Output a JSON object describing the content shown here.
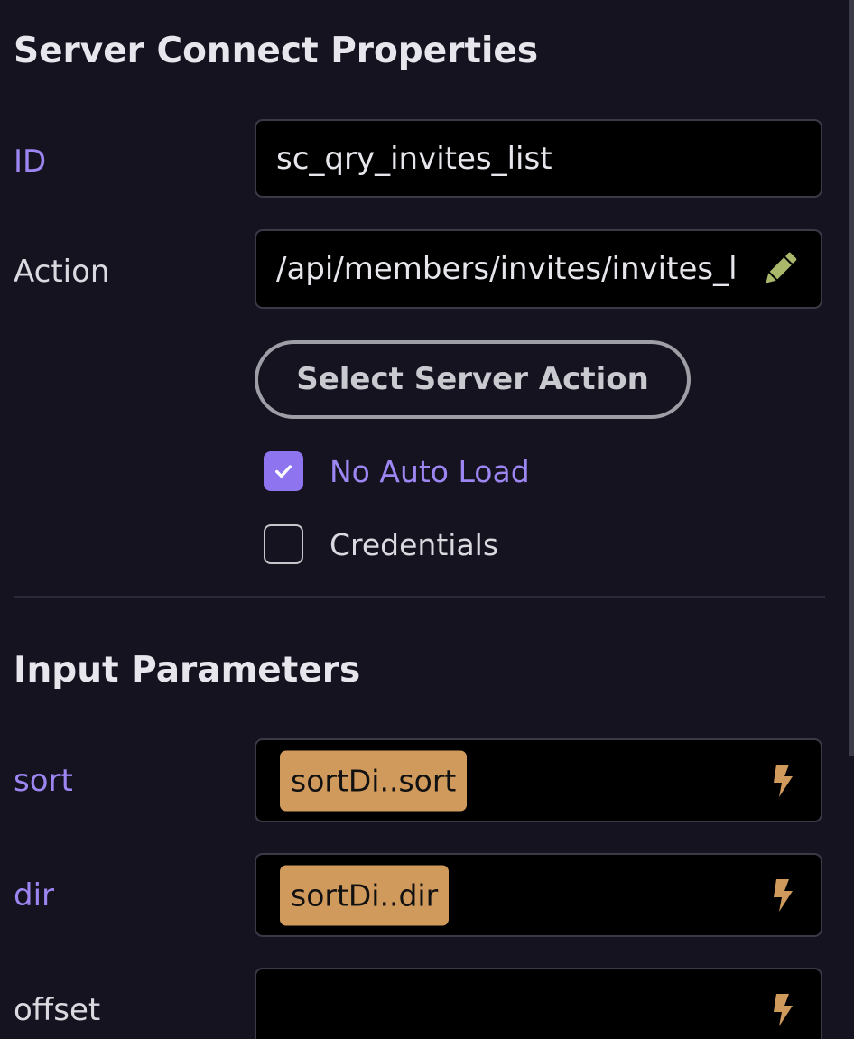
{
  "header": {
    "title": "Server Connect Properties"
  },
  "properties": {
    "id": {
      "label": "ID",
      "value": "sc_qry_invites_list"
    },
    "action": {
      "label": "Action",
      "value": "/api/members/invites/invites_l",
      "edit_icon": "pencil-icon"
    },
    "select_action_button": "Select Server Action",
    "no_auto_load": {
      "label": "No Auto Load",
      "checked": true
    },
    "credentials": {
      "label": "Credentials",
      "checked": false
    }
  },
  "input_parameters": {
    "title": "Input Parameters",
    "items": [
      {
        "label": "sort",
        "value": "sortDi..sort",
        "icon": "lightning-bolt-icon"
      },
      {
        "label": "dir",
        "value": "sortDi..dir",
        "icon": "lightning-bolt-icon"
      },
      {
        "label": "offset",
        "value": "",
        "icon": "lightning-bolt-icon"
      }
    ]
  },
  "colors": {
    "background": "#14131f",
    "accent": "#9d85f2",
    "checkbox_checked": "#8f74ef",
    "binding_pill": "#d19a5d",
    "pencil_icon": "#a9b86a",
    "bolt_icon": "#d19a5d"
  }
}
